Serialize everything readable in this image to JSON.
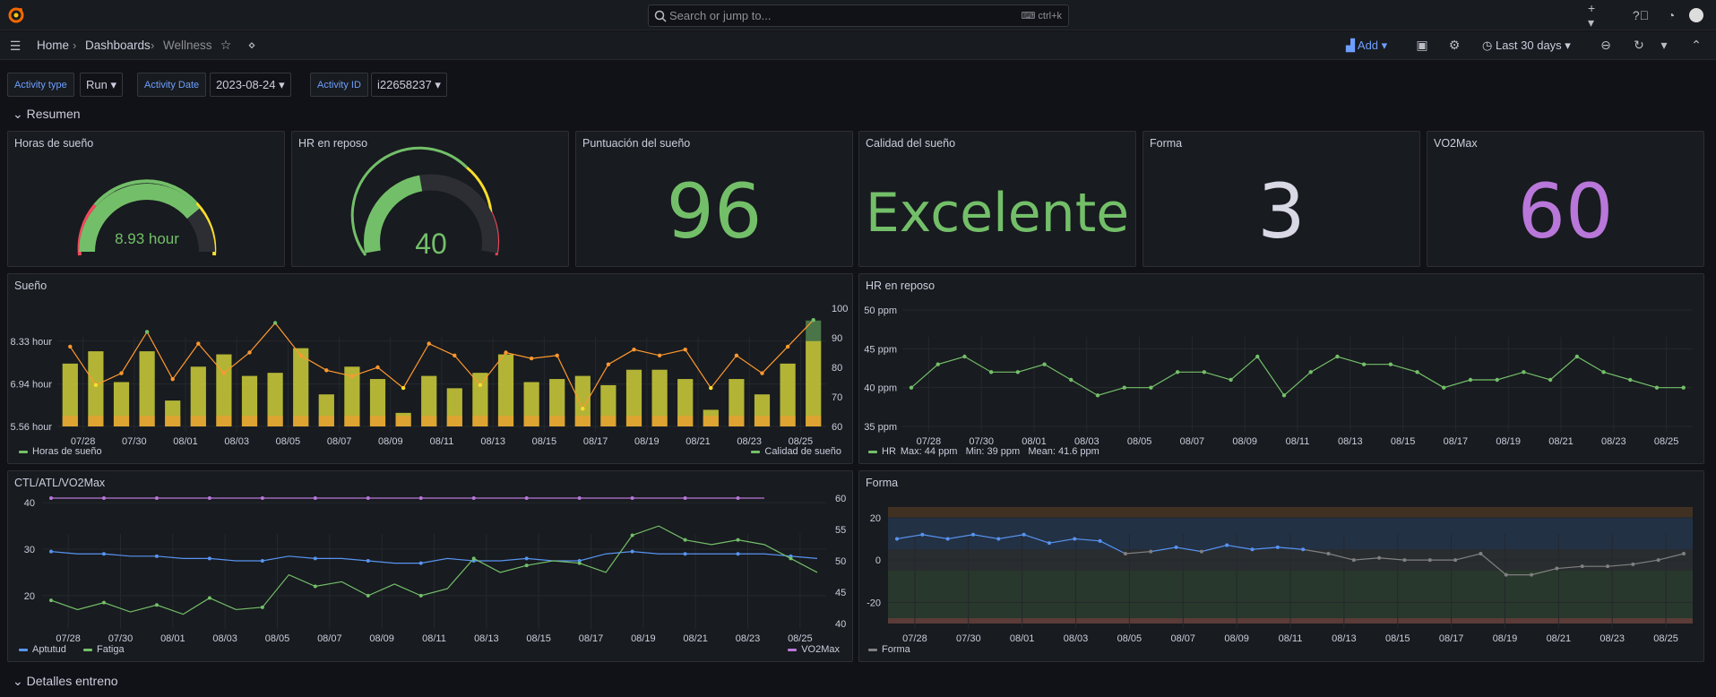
{
  "topbar": {
    "search_placeholder": "Search or jump to...",
    "search_shortcut": "ctrl+k"
  },
  "breadcrumb": {
    "home": "Home",
    "dashboards": "Dashboards",
    "current": "Wellness"
  },
  "toolbar": {
    "add_label": "Add",
    "time_range": "Last 30 days"
  },
  "variables": [
    {
      "label": "Activity type",
      "value": "Run"
    },
    {
      "label": "Activity Date",
      "value": "2023-08-24"
    },
    {
      "label": "Activity ID",
      "value": "i22658237"
    }
  ],
  "rows": {
    "resumen": "Resumen",
    "detalles": "Detalles entreno"
  },
  "stats": {
    "horas_sueno": {
      "title": "Horas de sueño",
      "value": "8.93 hour",
      "fraction": 0.78
    },
    "hr_reposo": {
      "title": "HR en reposo",
      "value": "40",
      "fraction": 0.45
    },
    "puntuacion": {
      "title": "Puntuación del sueño",
      "value": "96"
    },
    "calidad": {
      "title": "Calidad del sueño",
      "value": "Excelente"
    },
    "forma": {
      "title": "Forma",
      "value": "3"
    },
    "vo2max": {
      "title": "VO2Max",
      "value": "60"
    }
  },
  "colors": {
    "green": "#73bf69",
    "yellow": "#fade2a",
    "orange": "#ff9830",
    "blue": "#5794f2",
    "purple": "#b877d9",
    "gray": "#808080",
    "red": "#f2495c"
  },
  "chart_data": [
    {
      "type": "bar",
      "title": "Sueño",
      "x_ticks": [
        "07/28",
        "07/30",
        "08/01",
        "08/03",
        "08/05",
        "08/07",
        "08/09",
        "08/11",
        "08/13",
        "08/15",
        "08/17",
        "08/19",
        "08/21",
        "08/23",
        "08/25"
      ],
      "y_left_ticks": [
        "5.56 hour",
        "6.94 hour",
        "8.33 hour"
      ],
      "y_right_ticks": [
        "60",
        "70",
        "80",
        "90",
        "100"
      ],
      "ylim_left": [
        5.56,
        9.4
      ],
      "ylim_right": [
        60,
        100
      ],
      "series": [
        {
          "name": "Horas de sueño",
          "values": [
            7.6,
            8.0,
            7.0,
            8.0,
            6.4,
            7.5,
            7.9,
            7.2,
            7.3,
            8.1,
            6.6,
            7.5,
            7.1,
            6.0,
            7.2,
            6.8,
            7.3,
            7.9,
            7.0,
            7.1,
            7.2,
            6.9,
            7.4,
            7.4,
            7.1,
            6.1,
            7.1,
            6.6,
            7.6,
            9.0
          ]
        },
        {
          "name": "Calidad de sueño",
          "values": [
            87,
            74,
            78,
            92,
            76,
            88,
            78,
            85,
            95,
            84,
            79,
            77,
            80,
            73,
            88,
            84,
            74,
            85,
            83,
            84,
            66,
            81,
            86,
            84,
            86,
            73,
            84,
            78,
            87,
            96
          ]
        }
      ]
    },
    {
      "type": "line",
      "title": "HR en reposo",
      "x_ticks": [
        "07/28",
        "07/30",
        "08/01",
        "08/03",
        "08/05",
        "08/07",
        "08/09",
        "08/11",
        "08/13",
        "08/15",
        "08/17",
        "08/19",
        "08/21",
        "08/23",
        "08/25"
      ],
      "y_ticks": [
        "35 ppm",
        "40 ppm",
        "45 ppm",
        "50 ppm"
      ],
      "ylim": [
        35,
        50
      ],
      "series": [
        {
          "name": "HR",
          "values": [
            40,
            43,
            44,
            42,
            42,
            43,
            41,
            39,
            40,
            40,
            42,
            42,
            41,
            44,
            39,
            42,
            44,
            43,
            43,
            42,
            40,
            41,
            41,
            42,
            41,
            44,
            42,
            41,
            40,
            40
          ]
        }
      ],
      "legend_stats": "Max: 44 ppm   Min: 39 ppm   Mean: 41.6 ppm"
    },
    {
      "type": "line",
      "title": "CTL/ATL/VO2Max",
      "x_ticks": [
        "07/28",
        "07/30",
        "08/01",
        "08/03",
        "08/05",
        "08/07",
        "08/09",
        "08/11",
        "08/13",
        "08/15",
        "08/17",
        "08/19",
        "08/21",
        "08/23",
        "08/25"
      ],
      "y_left_ticks": [
        "20",
        "30",
        "40"
      ],
      "y_right_ticks": [
        "40",
        "45",
        "50",
        "55",
        "60"
      ],
      "ylim_left": [
        14,
        41
      ],
      "ylim_right": [
        40,
        60
      ],
      "series": [
        {
          "name": "Aptutud",
          "axis": "left",
          "values": [
            29.5,
            29,
            29,
            28.5,
            28.5,
            28,
            28,
            27.5,
            27.5,
            28.5,
            28,
            28,
            27.5,
            27,
            27,
            28,
            27.5,
            27.5,
            28,
            27.5,
            27.5,
            29,
            29.5,
            29,
            29,
            29,
            29,
            29,
            28.5,
            28
          ]
        },
        {
          "name": "Fatiga",
          "axis": "left",
          "values": [
            19,
            17,
            18.5,
            16.5,
            18,
            16,
            19.5,
            17,
            17.5,
            24.5,
            22,
            23,
            20,
            22.5,
            20,
            21.5,
            28,
            25,
            26.5,
            27.5,
            27,
            25,
            33,
            35,
            32,
            31,
            32,
            31,
            28,
            25
          ]
        },
        {
          "name": "VO2Max",
          "axis": "right",
          "values": [
            60,
            60,
            60,
            60,
            60,
            60,
            60,
            60,
            60,
            60,
            60,
            60,
            60,
            60,
            60,
            60,
            60,
            60,
            60,
            60,
            60,
            60,
            60,
            60,
            60,
            60,
            60,
            60
          ]
        }
      ]
    },
    {
      "type": "line",
      "title": "Forma",
      "x_ticks": [
        "07/28",
        "07/30",
        "08/01",
        "08/03",
        "08/05",
        "08/07",
        "08/09",
        "08/11",
        "08/13",
        "08/15",
        "08/17",
        "08/19",
        "08/21",
        "08/23",
        "08/25"
      ],
      "y_ticks": [
        "-20",
        "0",
        "20"
      ],
      "ylim": [
        -30,
        25
      ],
      "thresholds": [
        {
          "from": 20,
          "to": 25,
          "color": "#ff9830"
        },
        {
          "from": 5,
          "to": 20,
          "color": "#5794f2"
        },
        {
          "from": -5,
          "to": 5,
          "color": "#808080"
        },
        {
          "from": -30,
          "to": -5,
          "color": "#73bf69"
        }
      ],
      "series": [
        {
          "name": "Forma",
          "values": [
            10,
            12,
            10,
            12,
            10,
            12,
            8,
            10,
            9,
            3,
            4,
            6,
            4,
            7,
            5,
            6,
            5,
            3,
            0,
            1,
            0,
            0,
            0,
            3,
            -7,
            -7,
            -4,
            -3,
            -3,
            -2,
            0,
            3
          ]
        }
      ]
    }
  ]
}
